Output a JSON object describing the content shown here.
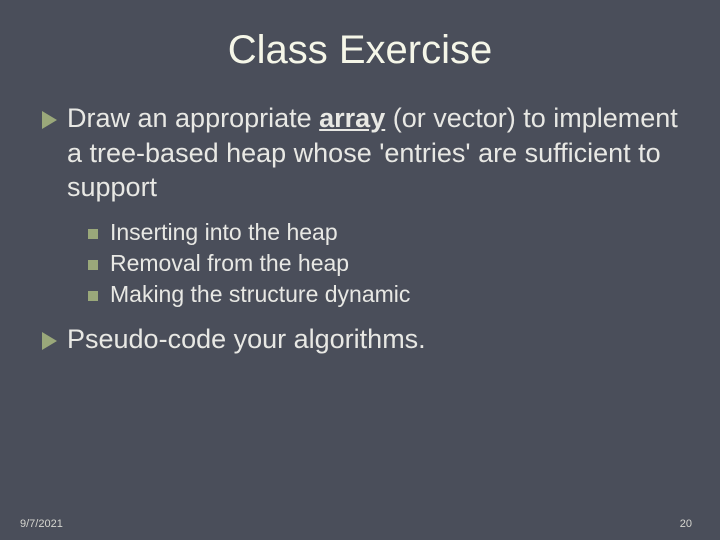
{
  "title": "Class Exercise",
  "bullets": {
    "b1": {
      "pre": "Draw an appropriate ",
      "bold": "array",
      "post": " (or vector) to implement a tree-based heap whose 'entries' are sufficient to support"
    },
    "sub1": "Inserting into the heap",
    "sub2": "Removal from the heap",
    "sub3": "Making the structure dynamic",
    "b2": "Pseudo-code your algorithms."
  },
  "footer": {
    "date": "9/7/2021",
    "page": "20"
  }
}
